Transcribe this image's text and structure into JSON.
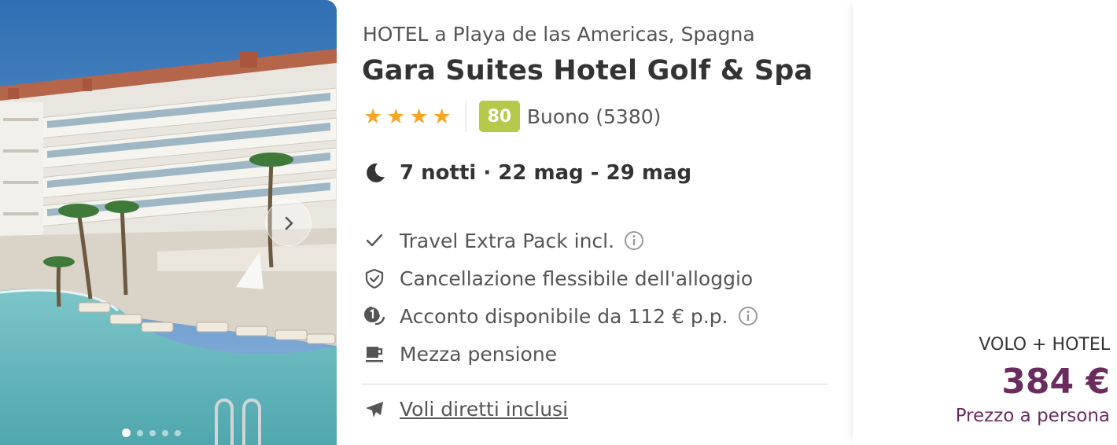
{
  "gallery": {
    "image_alt": "Hotel building with pool",
    "dots_count": 5,
    "active_dot": 0,
    "next_icon": "chevron-right-icon"
  },
  "hotel": {
    "subtitle": "HOTEL a Playa de las Americas, Spagna",
    "name": "Gara Suites Hotel Golf & Spa",
    "stars": 4,
    "score": "80",
    "score_label": "Buono (5380)",
    "score_color": "#b6c94a"
  },
  "stay": {
    "icon": "moon-icon",
    "text": "7 notti · 22 mag - 29 mag"
  },
  "features": [
    {
      "icon": "check-icon",
      "text": "Travel Extra Pack incl.",
      "info": true
    },
    {
      "icon": "shield-check-icon",
      "text": "Cancellazione flessibile dell'alloggio",
      "info": false
    },
    {
      "icon": "deposit-icon",
      "text": "Acconto disponibile da 112 € p.p.",
      "info": true
    },
    {
      "icon": "coffee-cup-icon",
      "text": "Mezza pensione",
      "info": false
    }
  ],
  "flight": {
    "icon": "airplane-icon",
    "text": "Voli diretti inclusi"
  },
  "price": {
    "type": "VOLO + HOTEL",
    "amount": "384 €",
    "note": "Prezzo a persona",
    "color": "#6a2c5f"
  }
}
